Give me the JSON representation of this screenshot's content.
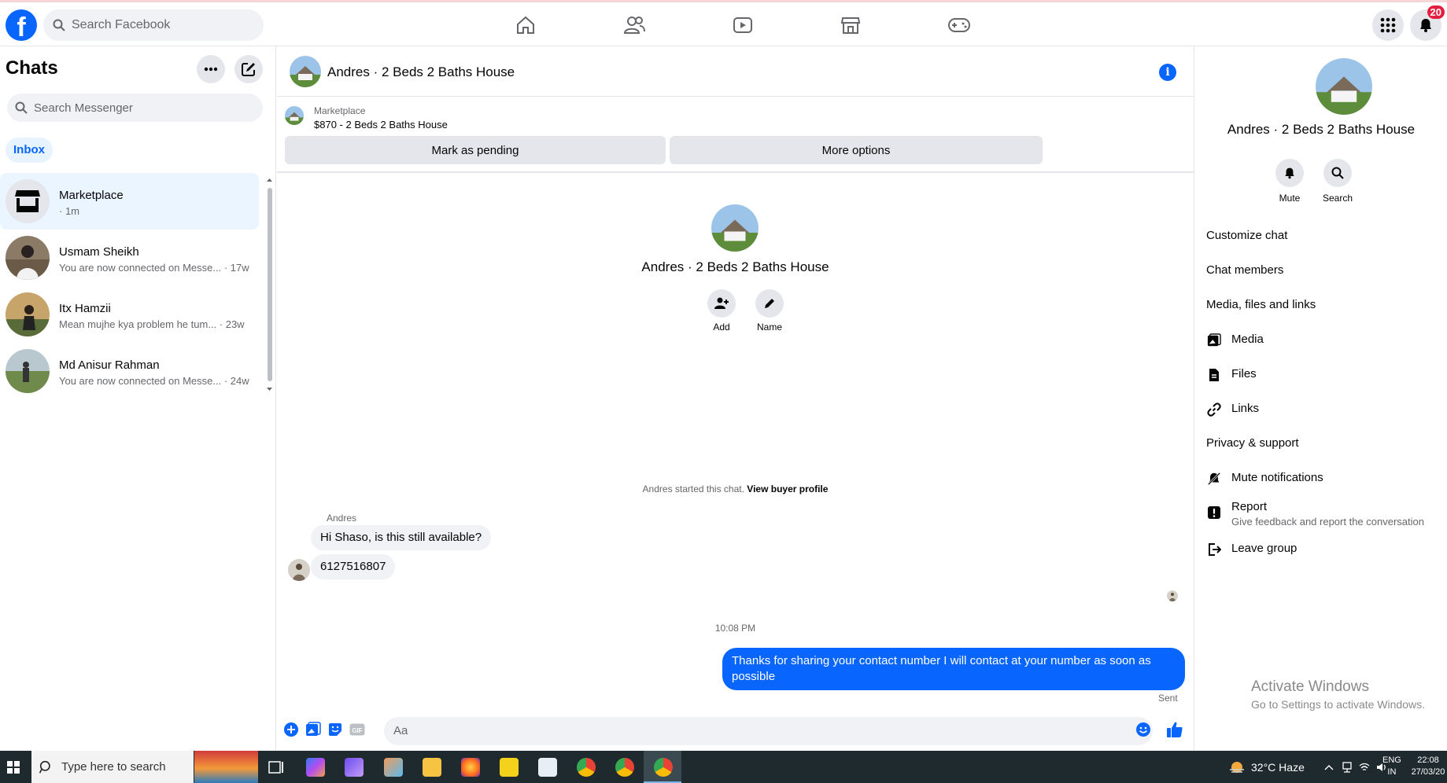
{
  "topbar": {
    "logo_letter": "f",
    "search_placeholder": "Search Facebook",
    "nav_icons": [
      "home-icon",
      "friends-icon",
      "watch-icon",
      "marketplace-icon",
      "gaming-icon"
    ],
    "notification_count": "20"
  },
  "sidebar": {
    "title": "Chats",
    "search_placeholder": "Search Messenger",
    "filter": "Inbox",
    "chats": [
      {
        "name": "Marketplace",
        "preview": "",
        "time": "· 1m",
        "active": true
      },
      {
        "name": "Usmam Sheikh",
        "preview": "You are now connected on Messe...",
        "time": "· 17w"
      },
      {
        "name": "Itx Hamzii",
        "preview": "Mean mujhe kya problem he tum...",
        "time": "· 23w"
      },
      {
        "name": "Md Anisur Rahman",
        "preview": "You are now connected on Messe...",
        "time": "· 24w"
      }
    ]
  },
  "conversation": {
    "title": "Andres · 2 Beds 2 Baths House",
    "marketplace_label": "Marketplace",
    "listing": "$870 - 2 Beds 2 Baths House",
    "mark_pending": "Mark as pending",
    "more_options": "More options",
    "hero_title": "Andres · 2 Beds 2 Baths House",
    "hero_actions": {
      "add": "Add",
      "name": "Name"
    },
    "started_text": "Andres started this chat.",
    "view_profile": "View buyer profile",
    "sender_name": "Andres",
    "incoming": [
      "Hi Shaso, is this still available?",
      "6127516807"
    ],
    "timestamp": "10:08 PM",
    "outgoing": "Thanks for sharing your contact number I will contact at your number as soon as possible",
    "sent_label": "Sent",
    "composer_placeholder": "Aa"
  },
  "details": {
    "title": "Andres · 2 Beds 2 Baths House",
    "mute": "Mute",
    "search": "Search",
    "customize": "Customize chat",
    "members": "Chat members",
    "media_section": "Media, files and links",
    "media": "Media",
    "files": "Files",
    "links": "Links",
    "privacy": "Privacy & support",
    "mute_notifications": "Mute notifications",
    "report": "Report",
    "report_sub": "Give feedback and report the conversation",
    "leave": "Leave group"
  },
  "watermark": {
    "line1": "Activate Windows",
    "line2": "Go to Settings to activate Windows."
  },
  "taskbar": {
    "search_placeholder": "Type here to search",
    "weather": "32°C  Haze",
    "lang1": "ENG",
    "lang2": "IN",
    "time": "22:08",
    "date": "27/03/20"
  },
  "colors": {
    "accent": "#0866ff",
    "bubble_in": "#f0f2f5",
    "selected": "#ebf5ff"
  }
}
